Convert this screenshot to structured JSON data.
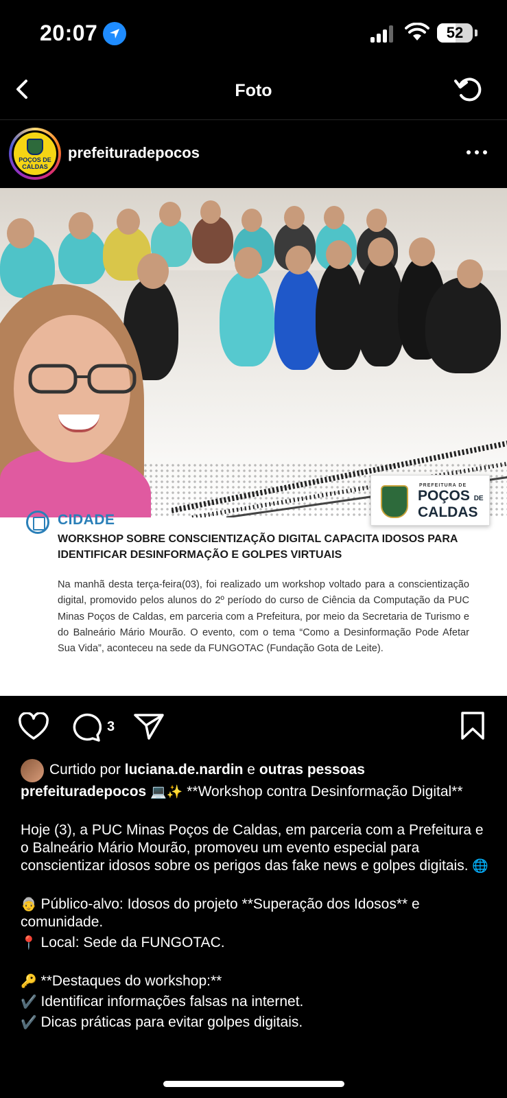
{
  "status_bar": {
    "time": "20:07",
    "battery": "52",
    "battery_level": 0.52
  },
  "nav": {
    "title": "Foto"
  },
  "post": {
    "username": "prefeituradepocos",
    "avatar_text": "POÇOS DE CALDAS"
  },
  "image": {
    "logo_small": "PREFEITURA DE",
    "logo_line1": "POÇOS",
    "logo_de": "DE",
    "logo_line2": "CALDAS",
    "section": "CIDADE",
    "headline": "WORKSHOP SOBRE CONSCIENTIZAÇÃO DIGITAL CAPACITA IDOSOS PARA IDENTIFICAR DESINFORMAÇÃO E GOLPES VIRTUAIS",
    "body": "Na manhã desta terça-feira(03), foi realizado um workshop voltado para a conscientização digital, promovido pelos alunos do 2º período do curso de Ciência da Computação da PUC Minas Poços de Caldas, em parceria com a Prefeitura, por meio da Secretaria de Turismo e do Balneário Mário Mourão. O evento, com o tema “Como a Desinformação Pode Afetar Sua Vida”, aconteceu na sede da FUNGOTAC (Fundação Gota de Leite)."
  },
  "actions": {
    "comment_count": "3"
  },
  "likes": {
    "prefix": "Curtido por",
    "user": "luciana.de.nardin",
    "conj": "e",
    "others": "outras pessoas"
  },
  "caption": {
    "username": "prefeituradepocos",
    "emoji1": "💻✨",
    "title": "**Workshop contra Desinformação Digital**",
    "para1": "Hoje (3), a PUC Minas Poços de Caldas, em parceria com a Prefeitura e o Balneário Mário Mourão, promoveu um evento especial para conscientizar idosos sobre os perigos das fake news e golpes digitais.",
    "globe": "🌐",
    "publico_emoji": "👵",
    "publico": "Público-alvo: Idosos do projeto **Superação dos Idosos** e comunidade.",
    "local_emoji": "📍",
    "local": "Local: Sede da FUNGOTAC.",
    "key_emoji": "🔑",
    "destaques": "**Destaques do workshop:**",
    "check": "✔️",
    "item1": "Identificar informações falsas na internet.",
    "item2": "Dicas práticas para evitar golpes digitais."
  }
}
